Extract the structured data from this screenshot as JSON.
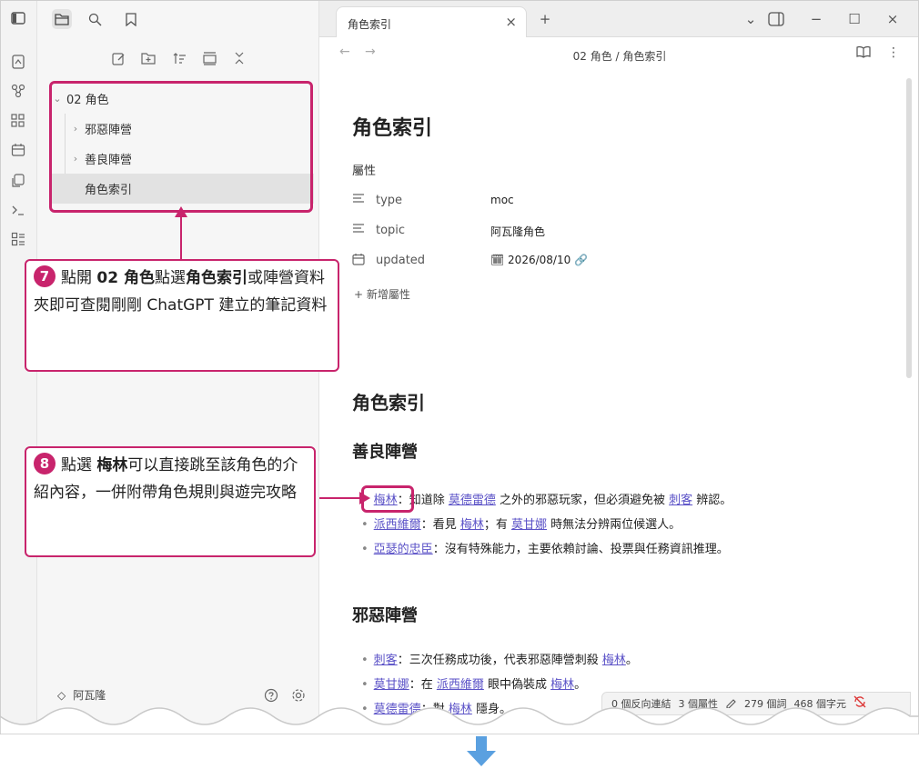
{
  "ribbon": {
    "icons": [
      "sidebar-toggle-icon",
      "open-quick-switcher-icon",
      "graph-icon",
      "canvas-icon",
      "calendar-icon",
      "copy-icon",
      "terminal-icon",
      "bases-icon"
    ]
  },
  "sidebar": {
    "top_icons": [
      "files-icon",
      "search-icon",
      "bookmark-icon"
    ],
    "tools": [
      "new-note-icon",
      "new-folder-icon",
      "sort-icon",
      "collapse-icon",
      "close-icon"
    ],
    "tree": [
      {
        "label": "02 角色",
        "chevron": "⌄",
        "level": 0
      },
      {
        "label": "邪惡陣營",
        "chevron": "›",
        "level": 1
      },
      {
        "label": "善良陣營",
        "chevron": "›",
        "level": 1
      },
      {
        "label": "角色索引",
        "chevron": "",
        "level": 1,
        "selected": true
      }
    ],
    "vault_name": "阿瓦隆",
    "vault_chevron": "◇"
  },
  "tabbar": {
    "tab_title": "角色索引",
    "close_glyph": "×",
    "add_glyph": "+",
    "controls": [
      "⌄",
      "▢",
      "−",
      "☐",
      "×"
    ]
  },
  "navbar": {
    "back": "←",
    "forward": "→",
    "breadcrumb": "02 角色 / 角色索引",
    "reading_icon": "📖",
    "more_icon": "⋮"
  },
  "note": {
    "title": "角色索引",
    "properties_header": "屬性",
    "properties": [
      {
        "icon": "☰",
        "key": "type",
        "value": "moc"
      },
      {
        "icon": "☰",
        "key": "topic",
        "value": "阿瓦隆角色"
      },
      {
        "icon": "🗓",
        "key": "updated",
        "value": "🗓 2026/08/10 🔗"
      }
    ],
    "add_property": "+ 新增屬性",
    "h2": "角色索引",
    "good_heading": "善良陣營",
    "good_items": [
      {
        "parts": [
          [
            "梅林",
            true
          ],
          [
            "：知道除 ",
            false
          ],
          [
            "莫德雷德",
            true
          ],
          [
            " 之外的邪惡玩家，但必須避免被 ",
            false
          ],
          [
            "刺客",
            true
          ],
          [
            " 辨認。",
            false
          ]
        ]
      },
      {
        "parts": [
          [
            "派西維爾",
            true
          ],
          [
            "：看見 ",
            false
          ],
          [
            "梅林",
            true
          ],
          [
            "；有 ",
            false
          ],
          [
            "莫甘娜",
            true
          ],
          [
            " 時無法分辨兩位候選人。",
            false
          ]
        ]
      },
      {
        "parts": [
          [
            "亞瑟的忠臣",
            true
          ],
          [
            "：沒有特殊能力，主要依賴討論、投票與任務資訊推理。",
            false
          ]
        ]
      }
    ],
    "evil_heading": "邪惡陣營",
    "evil_items": [
      {
        "parts": [
          [
            "刺客",
            true
          ],
          [
            "：三次任務成功後，代表邪惡陣營刺殺 ",
            false
          ],
          [
            "梅林",
            true
          ],
          [
            "。",
            false
          ]
        ]
      },
      {
        "parts": [
          [
            "莫甘娜",
            true
          ],
          [
            "：在 ",
            false
          ],
          [
            "派西維爾",
            true
          ],
          [
            " 眼中偽裝成 ",
            false
          ],
          [
            "梅林",
            true
          ],
          [
            "。",
            false
          ]
        ]
      },
      {
        "parts": [
          [
            "莫德雷德",
            true
          ],
          [
            "：對 ",
            false
          ],
          [
            "梅林",
            true
          ],
          [
            " 隱身。",
            false
          ]
        ]
      }
    ]
  },
  "statusbar": {
    "backlinks": "0 個反向連結",
    "properties": "3 個屬性",
    "words": "279 個詞",
    "chars": "468 個字元"
  },
  "annotations": {
    "callout7": {
      "num": "7",
      "p1": "點開 ",
      "b1": "02 角色",
      "p2": "點選",
      "b2": "角色索引",
      "p3": "或陣營資料夾即可查閱剛剛 ChatGPT 建立的筆記資料"
    },
    "callout8": {
      "num": "8",
      "p1": "點選 ",
      "b1": "梅林",
      "p2": "可以直接跳至該角色的介紹內容，一併附帶角色規則與遊完攻略"
    }
  },
  "colors": {
    "accent": "#c8246c",
    "link": "#5b52c7",
    "arrow": "#5aa0e0"
  }
}
